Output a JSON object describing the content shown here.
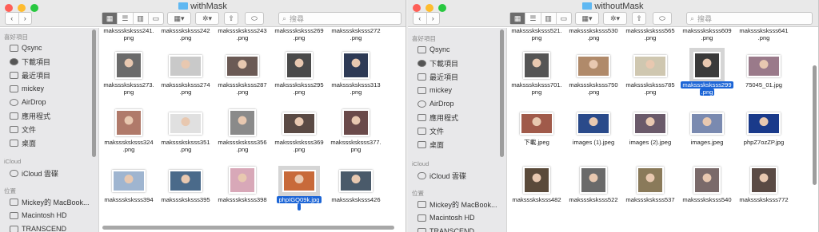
{
  "colors": {
    "red": "#fe5f57",
    "yellow": "#febc2e",
    "green": "#28c840",
    "selection": "#1c65d6",
    "folder": "#5fb8f2"
  },
  "toolbar": {
    "back_icon": "chevron-left-icon",
    "forward_icon": "chevron-right-icon",
    "view_icons": [
      "icon-view-icon",
      "list-view-icon",
      "column-view-icon",
      "gallery-view-icon"
    ],
    "group_label": "▾",
    "action_label": "▾",
    "search_placeholder": "搜尋"
  },
  "sidebar": {
    "favorites_heading": "喜好項目",
    "items": [
      {
        "label": "Qsync",
        "icon": "folder-icon"
      },
      {
        "label": "下載項目",
        "icon": "download-icon"
      },
      {
        "label": "最近項目",
        "icon": "clock-icon"
      },
      {
        "label": "mickey",
        "icon": "home-icon"
      },
      {
        "label": "AirDrop",
        "icon": "airdrop-icon"
      },
      {
        "label": "應用程式",
        "icon": "apps-icon"
      },
      {
        "label": "文件",
        "icon": "document-icon"
      },
      {
        "label": "桌面",
        "icon": "desktop-icon"
      }
    ],
    "icloud_heading": "iCloud",
    "icloud_items": [
      {
        "label": "iCloud 雲碟",
        "icon": "cloud-icon"
      }
    ],
    "locations_heading": "位置",
    "locations": [
      {
        "label": "Mickey的 MacBook...",
        "icon": "laptop-icon"
      },
      {
        "label": "Macintosh HD",
        "icon": "disk-icon"
      },
      {
        "label": "TRANSCEND",
        "icon": "disk-icon"
      }
    ]
  },
  "windows": [
    {
      "title": "withMask",
      "top_row": [
        "maksssksksss241.",
        "maksssksksss242",
        "maksssksksss243",
        "maksssksksss269",
        "maksssksksss272"
      ],
      "top_row_ext": [
        "png",
        ".png",
        ".png",
        ".png",
        ".png"
      ],
      "rows": [
        [
          {
            "n1": "maksssksksss273.",
            "n2": "png"
          },
          {
            "n1": "maksssksksss274",
            "n2": ".png"
          },
          {
            "n1": "maksssksksss287",
            "n2": ".png"
          },
          {
            "n1": "maksssksksss295",
            "n2": ".png"
          },
          {
            "n1": "maksssksksss313",
            "n2": ".png"
          }
        ],
        [
          {
            "n1": "maksssksksss324",
            "n2": ".png"
          },
          {
            "n1": "maksssksksss351",
            "n2": ".png"
          },
          {
            "n1": "maksssksksss356",
            "n2": ".png"
          },
          {
            "n1": "maksssksksss369",
            "n2": ".png"
          },
          {
            "n1": "maksssksksss377.",
            "n2": "png"
          }
        ],
        [
          {
            "n1": "maksssksksss394",
            "n2": ""
          },
          {
            "n1": "maksssksksss395",
            "n2": ""
          },
          {
            "n1": "maksssksksss398",
            "n2": ""
          },
          {
            "n1": "phpIGQ09k.jpg",
            "n2": ""
          },
          {
            "n1": "maksssksksss426",
            "n2": ""
          }
        ]
      ]
    },
    {
      "title": "withoutMask",
      "top_row": [
        "maksssksksss521.",
        "maksssksksss530",
        "maksssksksss565",
        "maksssksksss609",
        "maksssksksss641"
      ],
      "top_row_ext": [
        "png",
        ".png",
        ".png",
        ".png",
        ".png"
      ],
      "rows": [
        [
          {
            "n1": "maksssksksss701.",
            "n2": "png"
          },
          {
            "n1": "maksssksksss750",
            "n2": ".png"
          },
          {
            "n1": "maksssksksss785",
            "n2": ".png"
          },
          {
            "n1": "maksssksksss299",
            "n2": ".png"
          },
          {
            "n1": "75045_01.jpg",
            "n2": ""
          }
        ],
        [
          {
            "n1": "下載.jpeg",
            "n2": ""
          },
          {
            "n1": "images (1).jpeg",
            "n2": ""
          },
          {
            "n1": "images (2).jpeg",
            "n2": ""
          },
          {
            "n1": "images.jpeg",
            "n2": ""
          },
          {
            "n1": "phpZ7ozZP.jpg",
            "n2": ""
          }
        ],
        [
          {
            "n1": "maksssksksss482",
            "n2": ""
          },
          {
            "n1": "maksssksksss522",
            "n2": ""
          },
          {
            "n1": "maksssksksss537",
            "n2": ""
          },
          {
            "n1": "maksssksksss540",
            "n2": ""
          },
          {
            "n1": "maksssksksss772",
            "n2": ""
          }
        ]
      ]
    }
  ]
}
